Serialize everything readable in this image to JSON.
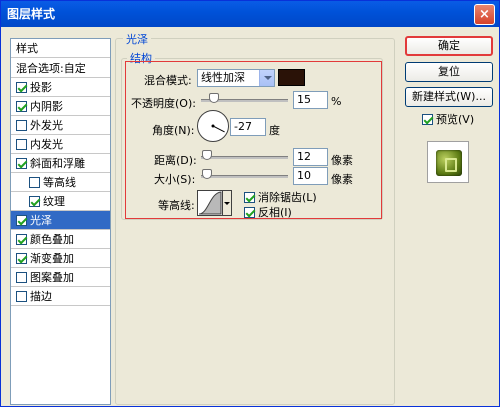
{
  "dialog": {
    "title": "图层样式",
    "close_glyph": "×"
  },
  "style_list": {
    "header": "样式",
    "items": [
      {
        "label": "混合选项:自定",
        "checkbox": false,
        "checked": false,
        "sub": false,
        "selected": false
      },
      {
        "label": "投影",
        "checkbox": true,
        "checked": true,
        "sub": false,
        "selected": false
      },
      {
        "label": "内阴影",
        "checkbox": true,
        "checked": true,
        "sub": false,
        "selected": false
      },
      {
        "label": "外发光",
        "checkbox": true,
        "checked": false,
        "sub": false,
        "selected": false
      },
      {
        "label": "内发光",
        "checkbox": true,
        "checked": false,
        "sub": false,
        "selected": false
      },
      {
        "label": "斜面和浮雕",
        "checkbox": true,
        "checked": true,
        "sub": false,
        "selected": false
      },
      {
        "label": "等高线",
        "checkbox": true,
        "checked": false,
        "sub": true,
        "selected": false
      },
      {
        "label": "纹理",
        "checkbox": true,
        "checked": true,
        "sub": true,
        "selected": false
      },
      {
        "label": "光泽",
        "checkbox": true,
        "checked": true,
        "sub": false,
        "selected": true
      },
      {
        "label": "颜色叠加",
        "checkbox": true,
        "checked": true,
        "sub": false,
        "selected": false
      },
      {
        "label": "渐变叠加",
        "checkbox": true,
        "checked": true,
        "sub": false,
        "selected": false
      },
      {
        "label": "图案叠加",
        "checkbox": true,
        "checked": false,
        "sub": false,
        "selected": false
      },
      {
        "label": "描边",
        "checkbox": true,
        "checked": false,
        "sub": false,
        "selected": false
      }
    ]
  },
  "satin": {
    "group_title": "光泽",
    "structure_title": "结构",
    "blend_mode_label": "混合模式:",
    "blend_mode_value": "线性加深",
    "color": "#2a1207",
    "opacity_label": "不透明度(O):",
    "opacity_value": "15",
    "opacity_unit": "%",
    "angle_label": "角度(N):",
    "angle_value": "-27",
    "angle_unit": "度",
    "distance_label": "距离(D):",
    "distance_value": "12",
    "distance_unit": "像素",
    "size_label": "大小(S):",
    "size_value": "10",
    "size_unit": "像素",
    "contour_label": "等高线:",
    "antialias_label": "消除锯齿(L)",
    "antialias_checked": true,
    "invert_label": "反相(I)",
    "invert_checked": true,
    "opacity_level": 0.15
  },
  "buttons": {
    "ok": "确定",
    "reset": "复位",
    "new_style": "新建样式(W)...",
    "preview_label": "预览(V)",
    "preview_checked": true
  }
}
